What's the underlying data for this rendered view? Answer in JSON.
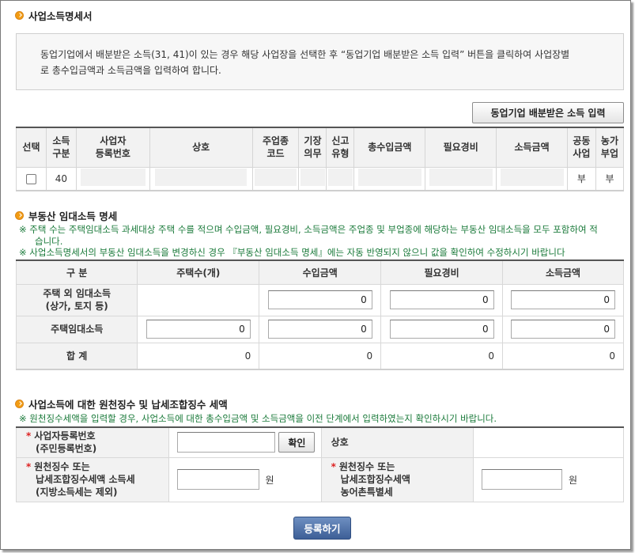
{
  "section1": {
    "title": "사업소득명세서",
    "info_line1": "동업기업에서 배분받은 소득(31, 41)이 있는 경우 해당 사업장을 선택한 후 “동업기업 배분받은 소득 입력” 버튼을 클릭하여 사업장별",
    "info_line2": "로 총수입금액과 소득금액을 입력하여 합니다.",
    "partner_button": "동업기업 배분받은 소득 입력",
    "columns": [
      "선택",
      "소득\n구분",
      "사업자\n등록번호",
      "상호",
      "주업종\n코드",
      "기장\n의무",
      "신고\n유형",
      "총수입금액",
      "필요경비",
      "소득금액",
      "공동\n사업",
      "농가\n부업"
    ],
    "row": {
      "income_type": "40",
      "joint_business": "부",
      "farm_side_job": "부"
    }
  },
  "section2": {
    "title": "부동산 임대소득 명세",
    "note1a": "※ 주택 수는 주택임대소득 과세대상 주택 수를 적으며 수입금액, 필요경비, 소득금액은 주업종 및 부업종에 해당하는 부동산 임대소득을 모두 포함하여 적",
    "note1b": "습니다.",
    "note2": "※ 사업소득명세서의 부동산 임대소득을 변경하신 경우 『부동산 임대소득 명세』에는 자동 반영되지 않으니 값을 확인하여 수정하시기 바랍니다",
    "headers": [
      "구 분",
      "주택수(개)",
      "수입금액",
      "필요경비",
      "소득금액"
    ],
    "row_nonhousing_label1": "주택 외 임대소득",
    "row_nonhousing_label2": "(상가, 토지 등)",
    "row_nonhousing": {
      "revenue": "0",
      "expense": "0",
      "income": "0"
    },
    "row_housing_label": "주택임대소득",
    "row_housing": {
      "count": "0",
      "revenue": "0",
      "expense": "0",
      "income": "0"
    },
    "row_total_label": "합 계",
    "row_total": {
      "count": "0",
      "revenue": "0",
      "expense": "0",
      "income": "0"
    }
  },
  "section3": {
    "title": "사업소득에 대한 원천징수 및 납세조합징수 세액",
    "note": "※ 원천징수세액을 입력할 경우, 사업소득에 대한 총수입금액 및 소득금액을 이전 단계에서 입력하였는지 확인하시기 바랍니다.",
    "req_mark": "*",
    "bizno_label1": "사업자등록번호",
    "bizno_label2": "(주민등록번호)",
    "confirm_button": "확인",
    "company_label": "상호",
    "withholding_label1": "원천징수 또는",
    "withholding_label2": "납세조합징수세액 소득세",
    "withholding_label3": "(지방소득세는 제외)",
    "rural_label1": "원천징수 또는",
    "rural_label2": "납세조합징수세액",
    "rural_label3": "농어촌특별세",
    "unit": "원"
  },
  "submit_button": "등록하기",
  "colors": {
    "accent_orange": "#f39c12",
    "note_green": "#1a7a3a",
    "submit_blue": "#3d5f97",
    "required_red": "#d22222"
  }
}
